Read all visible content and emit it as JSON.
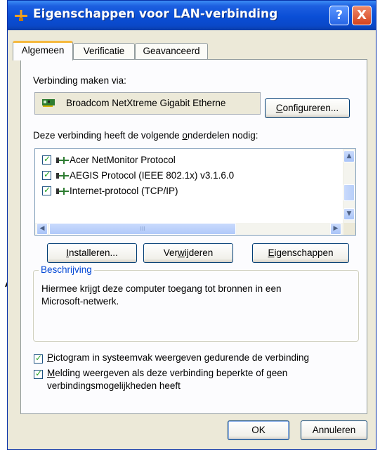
{
  "window": {
    "title": "Eigenschappen voor LAN-verbinding",
    "help_label": "?",
    "close_label": "X"
  },
  "tabs": [
    {
      "label": "Algemeen",
      "active": true
    },
    {
      "label": "Verificatie",
      "active": false
    },
    {
      "label": "Geavanceerd",
      "active": false
    }
  ],
  "connect_via": {
    "label": "Verbinding maken via:",
    "adapter_name": "Broadcom NetXtreme Gigabit Etherne",
    "configure_pre": "C",
    "configure_rest": "onfigureren...",
    "adapter_icon": "network-card-icon"
  },
  "components": {
    "label_pre": "Deze verbinding heeft de volgende ",
    "label_u": "o",
    "label_post": "nderdelen nodig:",
    "items": [
      {
        "label": "Acer NetMonitor Protocol",
        "checked": true
      },
      {
        "label": "AEGIS Protocol (IEEE 802.1x) v3.1.6.0",
        "checked": true
      },
      {
        "label": "Internet-protocol (TCP/IP)",
        "checked": true
      }
    ],
    "scroll_thumb_label": "III"
  },
  "actions": {
    "install_pre": "I",
    "install_rest": "nstalleren...",
    "remove_pre": "Ver",
    "remove_u": "w",
    "remove_post": "ijderen",
    "properties_pre": "E",
    "properties_rest": "igenschappen"
  },
  "description": {
    "title": "Beschrijving",
    "text_line1": "Hiermee krijgt deze computer toegang tot bronnen in een",
    "text_line2": "Microsoft-netwerk."
  },
  "options": {
    "tray_pre": "P",
    "tray_rest": "ictogram in systeemvak weergeven gedurende de verbinding",
    "tray_checked": true,
    "notify_pre": "M",
    "notify_rest": "elding weergeven als deze verbinding beperkte of geen",
    "notify_line2": "verbindingsmogelijkheden heeft",
    "notify_checked": true
  },
  "footer": {
    "ok_label": "OK",
    "cancel_label": "Annuleren"
  },
  "colors": {
    "titlebar": "#0a4ed6",
    "face": "#ece9d8",
    "groupbox_title": "#0046d5",
    "check": "#21a121"
  }
}
